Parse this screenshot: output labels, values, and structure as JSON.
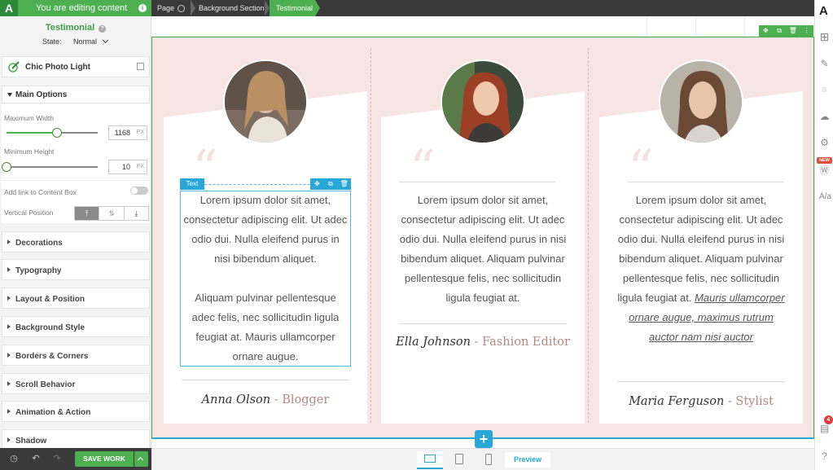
{
  "topbar": {
    "logo": "A",
    "editing_label": "You are editing content",
    "breadcrumbs": [
      "Page",
      "Background Section",
      "Testimonial"
    ]
  },
  "panel": {
    "element_title": "Testimonial",
    "state_label": "State:",
    "state_value": "Normal",
    "preset_name": "Chic Photo Light",
    "main_options": {
      "title": "Main Options",
      "max_width_label": "Maximum Width",
      "max_width_value": "1168",
      "max_width_fraction": 0.55,
      "min_height_label": "Minimum Height",
      "min_height_value": "10",
      "min_height_fraction": 0.0,
      "unit": "PX",
      "link_label": "Add link to Content Box",
      "link_enabled": false,
      "vpos_label": "Vertical Position",
      "vpos_options": [
        "⤒",
        "⥮",
        "⤓"
      ],
      "vpos_selected": 0
    },
    "sections": [
      "Decorations",
      "Typography",
      "Layout & Position",
      "Background Style",
      "Borders & Corners",
      "Scroll Behavior",
      "Animation & Action",
      "Shadow"
    ],
    "save_label": "SAVE WORK"
  },
  "canvas": {
    "text_tag": "Text",
    "cards": [
      {
        "paragraphs": [
          "Lorem ipsum dolor sit amet, consectetur adipiscing elit. Ut adec odio dui. Nulla eleifend purus in nisi bibendum aliquet.",
          "Aliquam pulvinar pellentesque adec felis, nec sollicitudin ligula feugiat at. Mauris ullamcorper ornare augue."
        ],
        "name": "Anna Olson",
        "role": "Blogger"
      },
      {
        "paragraphs": [
          "Lorem ipsum dolor sit amet, consectetur adipiscing elit. Ut adec odio dui. Nulla eleifend purus in nisi bibendum aliquet. Aliquam pulvinar pellentesque felis, nec sollicitudin ligula feugiat at."
        ],
        "name": "Ella Johnson",
        "role": "Fashion Editor"
      },
      {
        "text": "Lorem ipsum dolor sit amet, consectetur adipiscing elit. Ut adec odio dui. Nulla eleifend purus in nisi bibendum aliquet. Aliquam pulvinar pellentesque felis, nec sollicitudin ligula feugiat at.",
        "link_text": "Mauris ullamcorper ornare augue, maximus rutrum auctor nam nisi auctor",
        "name": "Maria Ferguson",
        "role": "Stylist"
      }
    ],
    "quote_glyph": "“",
    "role_separator": " - "
  },
  "bottom": {
    "preview_label": "Preview"
  },
  "rail": {
    "new_badge": "NEW",
    "notifications": "4"
  },
  "colors": {
    "brand_green": "#4caf50",
    "accent_blue": "#29a8d8",
    "section_bg": "#f7e5e3",
    "role_color": "#b08a80"
  }
}
